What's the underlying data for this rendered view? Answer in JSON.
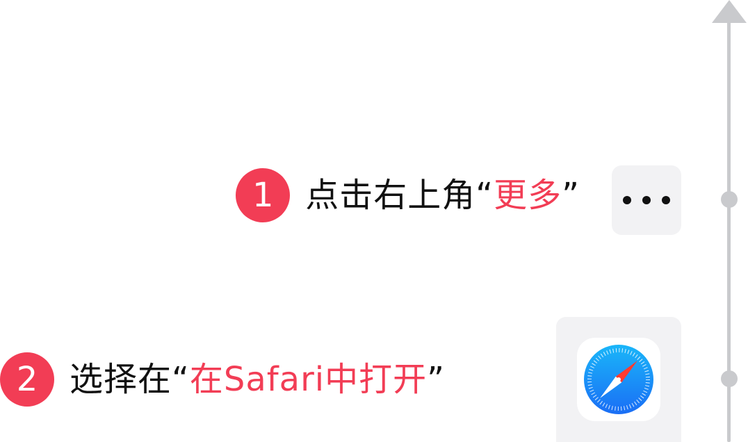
{
  "steps": [
    {
      "number": "1",
      "text_before": "点击右上角“",
      "highlight": "更多",
      "text_after": "”"
    },
    {
      "number": "2",
      "text_before": "选择在“",
      "highlight": "在Safari中打开",
      "text_after": "”"
    }
  ],
  "icons": {
    "more": "ellipsis-icon",
    "safari": "safari-compass-icon",
    "guide_arrow": "arrow-up-icon"
  },
  "colors": {
    "accent": "#f23d55",
    "text": "#111111",
    "guide": "#c9cacd",
    "tile_bg": "#f2f2f4",
    "safari_blue_top": "#1ab6f9",
    "safari_blue_bottom": "#1a6ef5"
  }
}
